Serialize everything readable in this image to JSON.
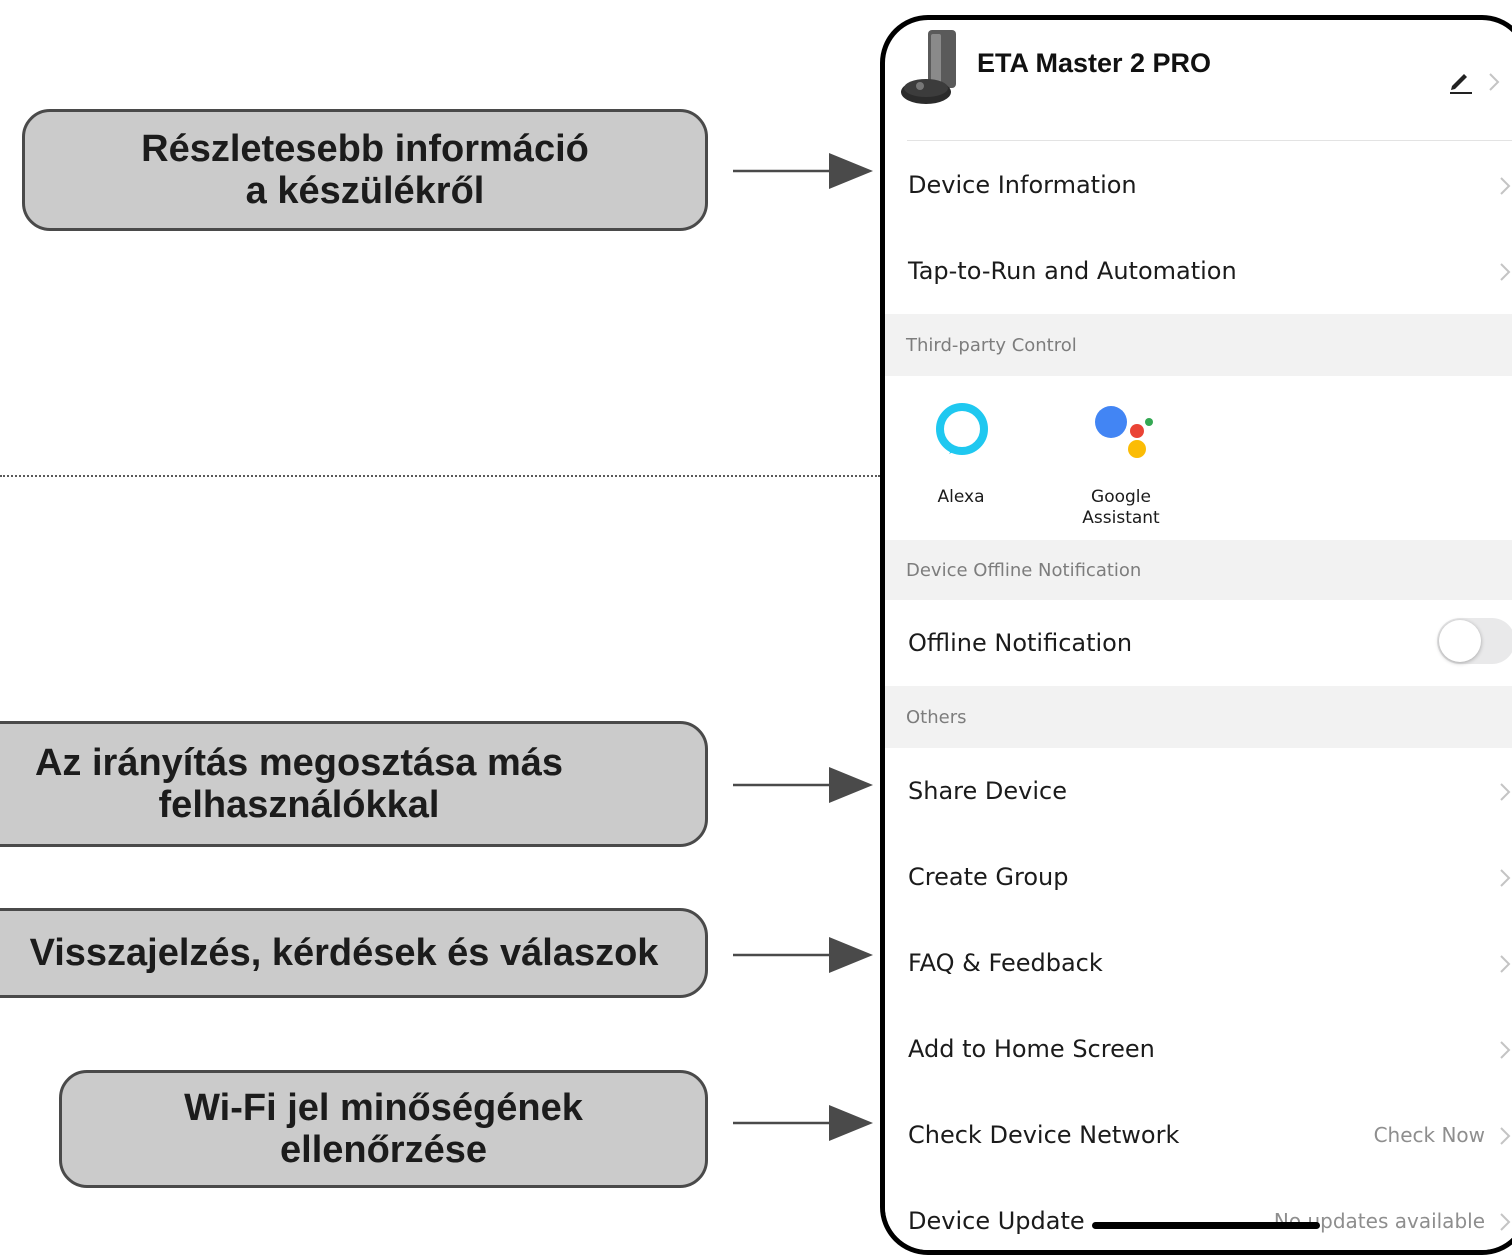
{
  "callouts": {
    "device_info": "Részletesebb információ\na készülékről",
    "share": "Az irányítás megosztása más\nfelhasználókkal",
    "faq": "Visszajelzés, kérdések és válaszok",
    "wifi": "Wi-Fi jel minőségének\nellenőrzése"
  },
  "header": {
    "title": "ETA Master 2 PRO"
  },
  "rows": {
    "device_information": "Device Information",
    "tap_to_run": "Tap-to-Run and Automation",
    "offline_notification": "Offline Notification",
    "share_device": "Share Device",
    "create_group": "Create Group",
    "faq_feedback": "FAQ & Feedback",
    "add_home": "Add to Home Screen",
    "check_network": "Check Device Network",
    "check_network_value": "Check Now",
    "device_update": "Device Update",
    "device_update_value": "No updates available"
  },
  "sections": {
    "third_party": "Third-party Control",
    "offline": "Device Offline Notification",
    "others": "Others"
  },
  "third_party": {
    "alexa": "Alexa",
    "google": "Google\nAssistant"
  },
  "offline_toggle_on": false,
  "icons": [
    "robot-vacuum-icon",
    "edit-pencil-icon",
    "chevron-right-icon",
    "alexa-icon",
    "google-assistant-icon"
  ],
  "colors": {
    "alexa": "#1fc8f0",
    "google_blue": "#4285f4",
    "google_red": "#ea4335",
    "google_yellow": "#fbbc05",
    "google_green": "#34a853",
    "callout_fill": "#cbcbcb"
  }
}
